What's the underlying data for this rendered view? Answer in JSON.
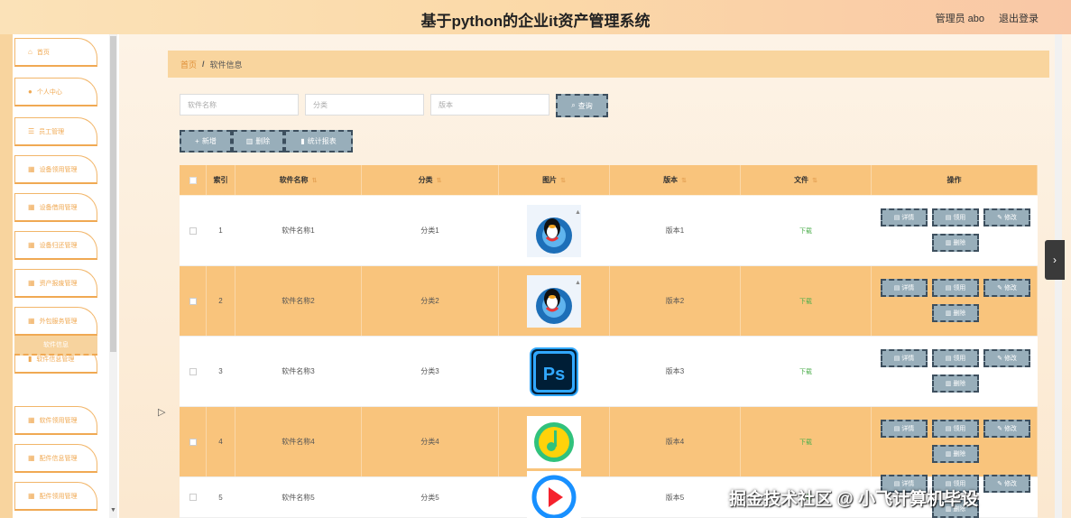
{
  "header": {
    "title": "基于python的企业it资产管理系统",
    "user": "管理员 abo",
    "logout": "退出登录"
  },
  "sidebar": {
    "items": [
      {
        "label": "首页",
        "icon": "home-icon"
      },
      {
        "label": "个人中心",
        "icon": "user-icon"
      },
      {
        "label": "员工管理",
        "icon": "list-icon"
      },
      {
        "label": "设备领用管理",
        "icon": "grid-icon"
      },
      {
        "label": "设备借用管理",
        "icon": "grid-icon"
      },
      {
        "label": "设备归还管理",
        "icon": "grid-icon"
      },
      {
        "label": "资产报废管理",
        "icon": "grid-icon"
      },
      {
        "label": "外包服务管理",
        "icon": "grid-icon"
      },
      {
        "label": "软件信息管理",
        "icon": "chart-icon"
      },
      {
        "label": "软件领用管理",
        "icon": "grid-icon"
      },
      {
        "label": "配件信息管理",
        "icon": "grid-icon"
      },
      {
        "label": "配件领用管理",
        "icon": "grid-icon"
      }
    ],
    "active_sub": "软件信息"
  },
  "breadcrumb": {
    "home": "首页",
    "separator": "/",
    "current": "软件信息"
  },
  "search": {
    "name_placeholder": "软件名称",
    "category_placeholder": "分类",
    "version_placeholder": "版本",
    "query_label": "查询"
  },
  "toolbar": {
    "add_label": "新增",
    "delete_label": "删除",
    "stats_label": "统计报表"
  },
  "table": {
    "headers": {
      "index": "索引",
      "name": "软件名称",
      "category": "分类",
      "image": "图片",
      "version": "版本",
      "file": "文件",
      "action": "操作"
    },
    "rows": [
      {
        "index": "1",
        "name": "软件名称1",
        "category": "分类1",
        "image": "qq-penguin",
        "version": "版本1",
        "file": "下载"
      },
      {
        "index": "2",
        "name": "软件名称2",
        "category": "分类2",
        "image": "qq-penguin",
        "version": "版本2",
        "file": "下载"
      },
      {
        "index": "3",
        "name": "软件名称3",
        "category": "分类3",
        "image": "photoshop",
        "version": "版本3",
        "file": "下载"
      },
      {
        "index": "4",
        "name": "软件名称4",
        "category": "分类4",
        "image": "qq-music",
        "version": "版本4",
        "file": "下载"
      },
      {
        "index": "5",
        "name": "软件名称5",
        "category": "分类5",
        "image": "video-player",
        "version": "版本5",
        "file": "下载"
      }
    ],
    "row_actions": {
      "detail": "详情",
      "borrow": "领用",
      "edit": "修改",
      "delete": "删除"
    }
  },
  "watermark": "掘金技术社区 @ 小飞计算机毕设"
}
